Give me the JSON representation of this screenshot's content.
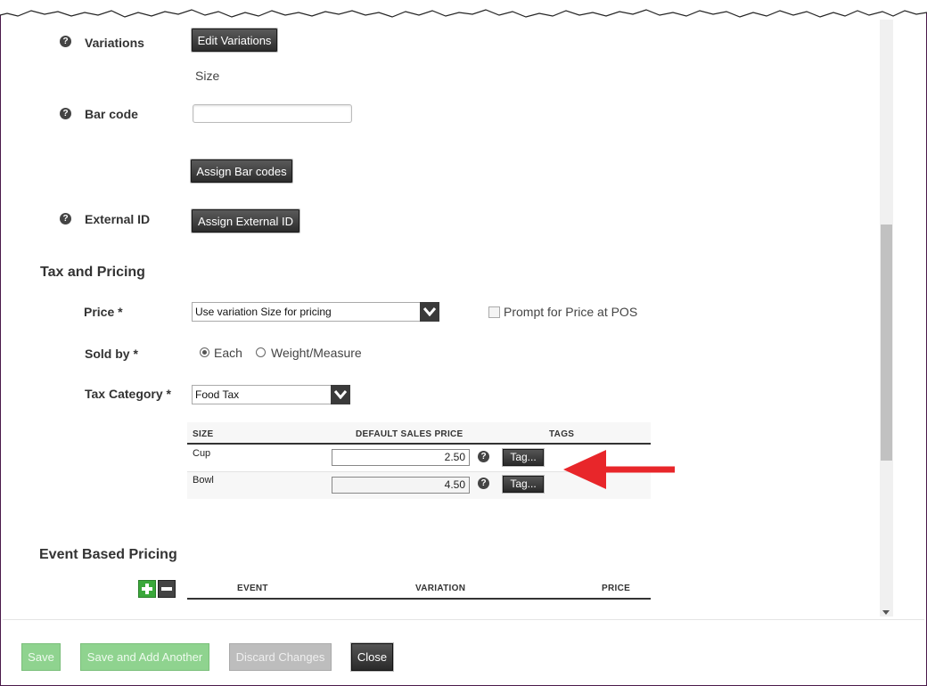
{
  "variations": {
    "label": "Variations",
    "button": "Edit Variations",
    "value": "Size"
  },
  "barcode": {
    "label": "Bar code",
    "input_value": "",
    "button": "Assign Bar codes"
  },
  "external_id": {
    "label": "External ID",
    "button": "Assign External ID"
  },
  "tax_pricing": {
    "title": "Tax and Pricing",
    "price": {
      "label": "Price *",
      "selected": "Use variation Size for pricing",
      "checkbox_label": "Prompt for Price at POS",
      "checkbox_checked": false
    },
    "sold_by": {
      "label": "Sold by *",
      "options": [
        "Each",
        "Weight/Measure"
      ],
      "selected": "Each"
    },
    "tax_category": {
      "label": "Tax Category *",
      "selected": "Food Tax"
    },
    "table": {
      "headers": [
        "SIZE",
        "DEFAULT SALES PRICE",
        "TAGS"
      ],
      "rows": [
        {
          "size": "Cup",
          "price": "2.50",
          "tag_button": "Tag..."
        },
        {
          "size": "Bowl",
          "price": "4.50",
          "tag_button": "Tag..."
        }
      ]
    }
  },
  "event_pricing": {
    "title": "Event Based Pricing",
    "headers": [
      "EVENT",
      "VARIATION",
      "PRICE"
    ]
  },
  "footer": {
    "save": "Save",
    "save_add": "Save and Add Another",
    "discard": "Discard Changes",
    "close": "Close"
  },
  "colors": {
    "annotation_arrow": "#e8262a",
    "frame": "#4a1a4a",
    "save_green": "#8fd38f"
  },
  "icons": [
    "help-icon",
    "dropdown-arrow-icon",
    "plus-icon",
    "minus-icon",
    "scroll-down-arrow-icon"
  ]
}
